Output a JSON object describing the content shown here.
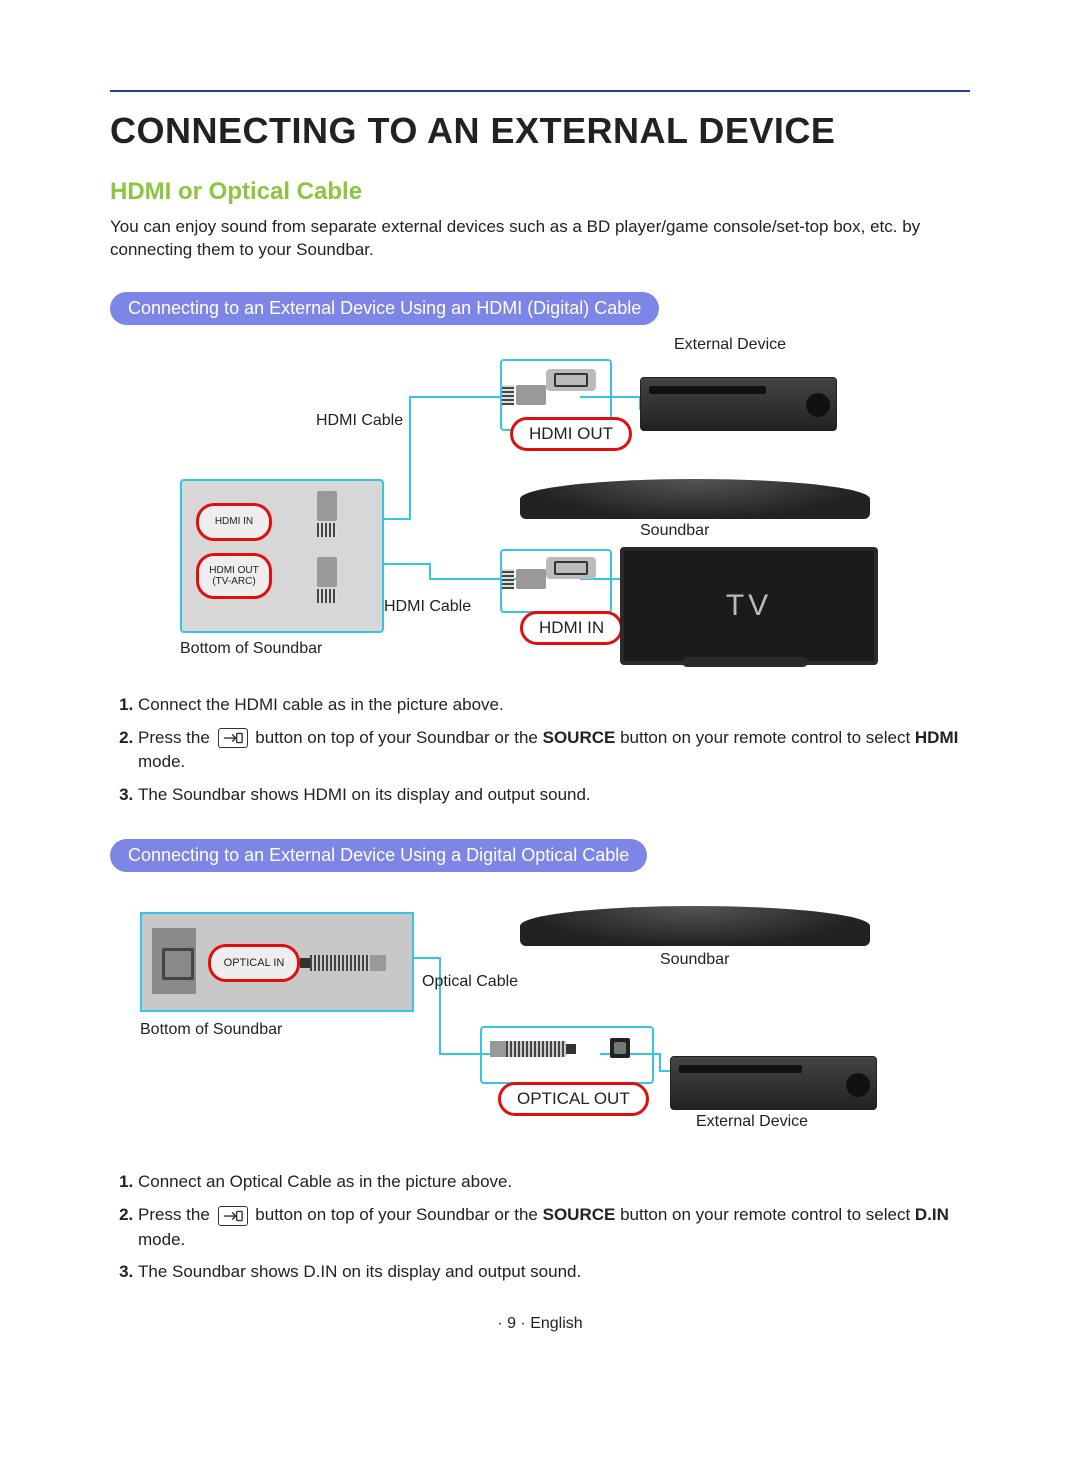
{
  "title": "CONNECTING TO AN EXTERNAL DEVICE",
  "section_title": "HDMI or Optical Cable",
  "intro": "You can enjoy sound from separate external devices such as a BD player/game console/set-top box, etc. by connecting them to your Soundbar.",
  "hdmi": {
    "pill": "Connecting to an External Device Using an HDMI (Digital) Cable",
    "labels": {
      "external_device": "External Device",
      "hdmi_cable_top": "HDMI Cable",
      "hdmi_cable_mid": "HDMI Cable",
      "hdmi_out": "HDMI OUT",
      "hdmi_in": "HDMI IN",
      "hdmi_in_port": "HDMI IN",
      "hdmi_out_port_line1": "HDMI OUT",
      "hdmi_out_port_line2": "(TV-ARC)",
      "soundbar": "Soundbar",
      "tv": "TV",
      "bottom_soundbar": "Bottom of Soundbar"
    },
    "steps": {
      "s1": "Connect the HDMI cable as in the picture above.",
      "s2a": "Press the ",
      "s2b": " button on top of your Soundbar or the ",
      "s2_source": "SOURCE",
      "s2c": " button on your remote control to select ",
      "s2_mode": "HDMI",
      "s2d": " mode.",
      "s3": "The Soundbar shows HDMI on its display and output sound."
    }
  },
  "optical": {
    "pill": "Connecting to an External Device Using a Digital Optical Cable",
    "labels": {
      "optical_in": "OPTICAL IN",
      "optical_out": "OPTICAL OUT",
      "optical_cable": "Optical Cable",
      "soundbar": "Soundbar",
      "bottom_soundbar": "Bottom of Soundbar",
      "external_device": "External Device"
    },
    "steps": {
      "s1": "Connect an Optical Cable as in the picture above.",
      "s2a": "Press the ",
      "s2b": " button on top of your Soundbar or the ",
      "s2_source": "SOURCE",
      "s2c": " button on your remote control to select ",
      "s2_mode": "D.IN",
      "s2d": " mode.",
      "s3": "The Soundbar shows D.IN on its display and output sound."
    }
  },
  "footer": "· 9 · English"
}
